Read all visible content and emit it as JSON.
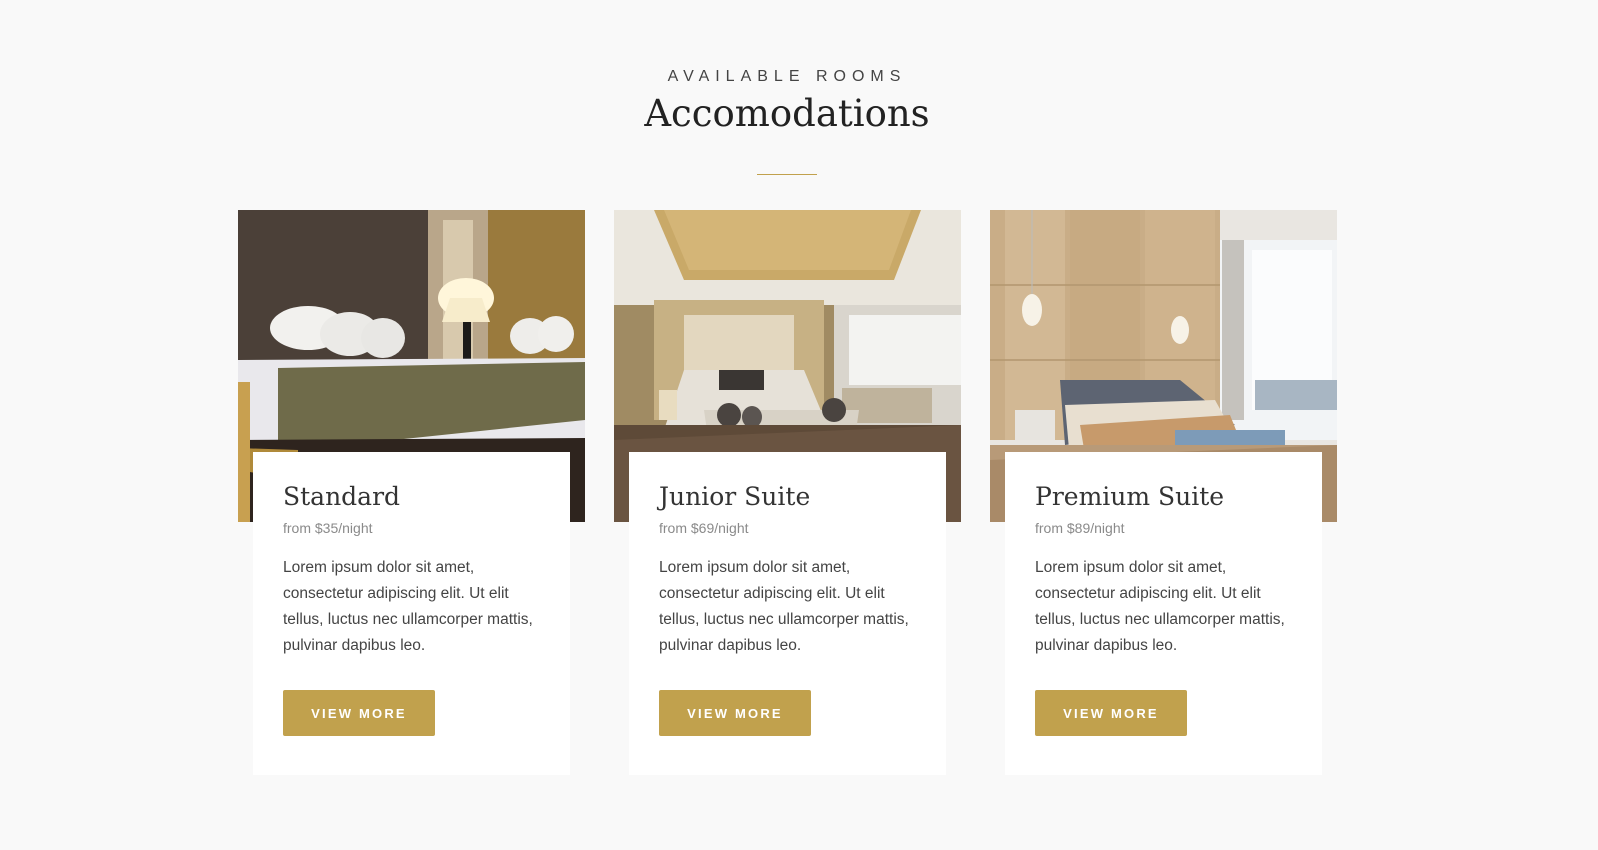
{
  "header": {
    "eyebrow": "AVAILABLE ROOMS",
    "title": "Accomodations"
  },
  "colors": {
    "accent": "#c1a14d",
    "background": "#f9f9f9",
    "card": "#ffffff"
  },
  "rooms": [
    {
      "name": "Standard",
      "price": "from $35/night",
      "description": "Lorem ipsum dolor sit amet, consectetur adipiscing elit. Ut elit tellus, luctus nec ullamcorper mattis, pulvinar dapibus leo.",
      "button_label": "VIEW MORE"
    },
    {
      "name": "Junior Suite",
      "price": "from $69/night",
      "description": "Lorem ipsum dolor sit amet, consectetur adipiscing elit. Ut elit tellus, luctus nec ullamcorper mattis, pulvinar dapibus leo.",
      "button_label": "VIEW MORE"
    },
    {
      "name": "Premium Suite",
      "price": "from $89/night",
      "description": "Lorem ipsum dolor sit amet, consectetur adipiscing elit. Ut elit tellus, luctus nec ullamcorper mattis, pulvinar dapibus leo.",
      "button_label": "VIEW MORE"
    }
  ]
}
